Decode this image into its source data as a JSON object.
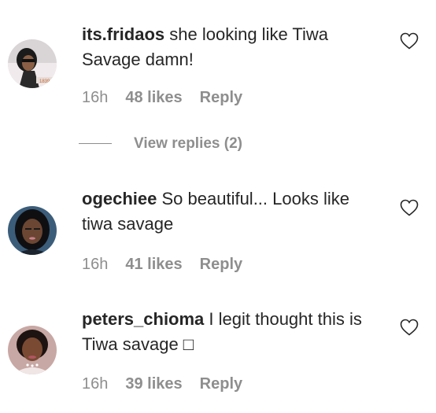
{
  "comments": [
    {
      "username": "its.fridaos",
      "text": "she looking like Tiwa Savage damn!",
      "time": "16h",
      "likes": "48 likes",
      "reply": "Reply",
      "view_replies": "View replies (2)"
    },
    {
      "username": "ogechiee",
      "text": "So beautiful... Looks like tiwa savage",
      "time": "16h",
      "likes": "41 likes",
      "reply": "Reply"
    },
    {
      "username": "peters_chioma",
      "text": "I legit thought this is Tiwa savage □",
      "time": "16h",
      "likes": "39 likes",
      "reply": "Reply"
    }
  ],
  "icons": {
    "like": "heart-outline-icon"
  },
  "colors": {
    "text": "#262626",
    "secondary": "#8e8e8e",
    "background": "#ffffff"
  }
}
